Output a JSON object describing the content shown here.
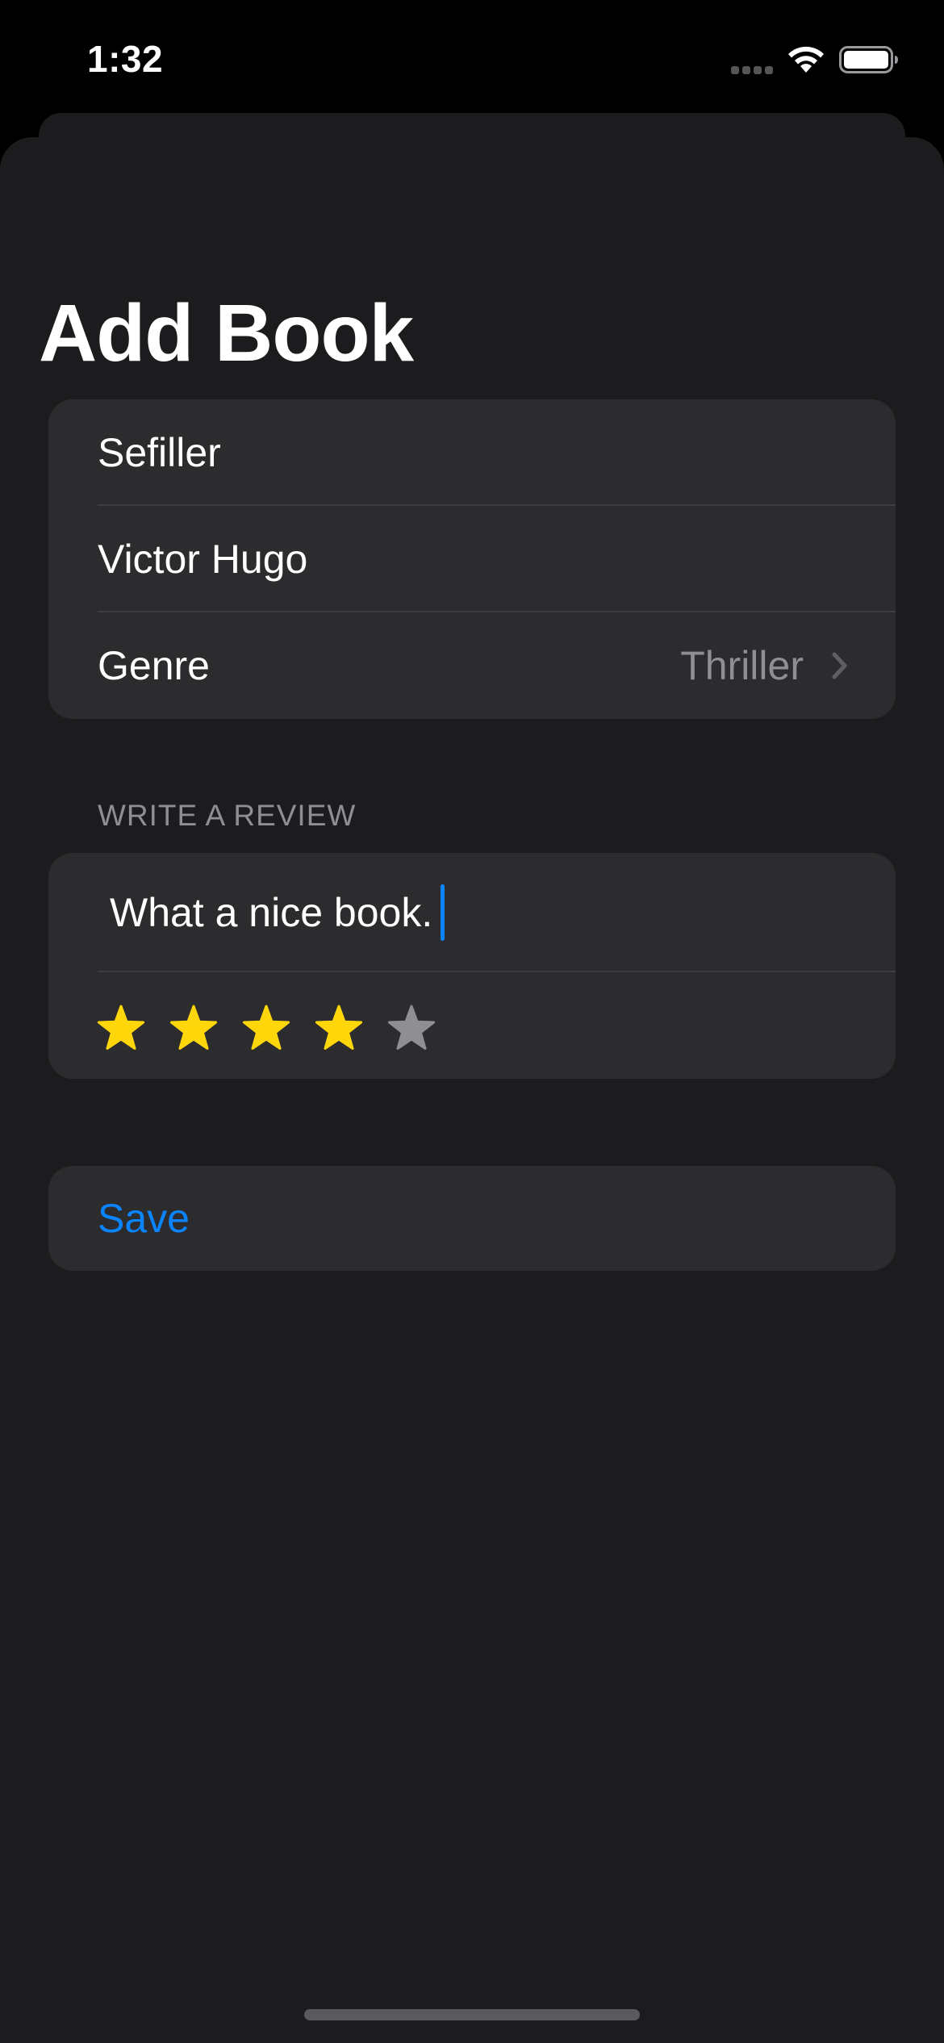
{
  "status_bar": {
    "time": "1:32",
    "icons": [
      "cellular-signal-icon",
      "wifi-icon",
      "battery-icon"
    ]
  },
  "page": {
    "title": "Add Book"
  },
  "book_form": {
    "title_value": "Sefiller",
    "author_value": "Victor Hugo",
    "genre_label": "Genre",
    "genre_value": "Thriller"
  },
  "review_section": {
    "header": "WRITE A REVIEW",
    "review_text": "What a nice book.",
    "rating": 4,
    "max_rating": 5
  },
  "actions": {
    "save_label": "Save"
  },
  "colors": {
    "accent": "#0a84ff",
    "star_filled": "#ffd60a",
    "star_empty": "#8e8e93",
    "background": "#1c1c1e",
    "cell_background": "#2c2c2e"
  }
}
